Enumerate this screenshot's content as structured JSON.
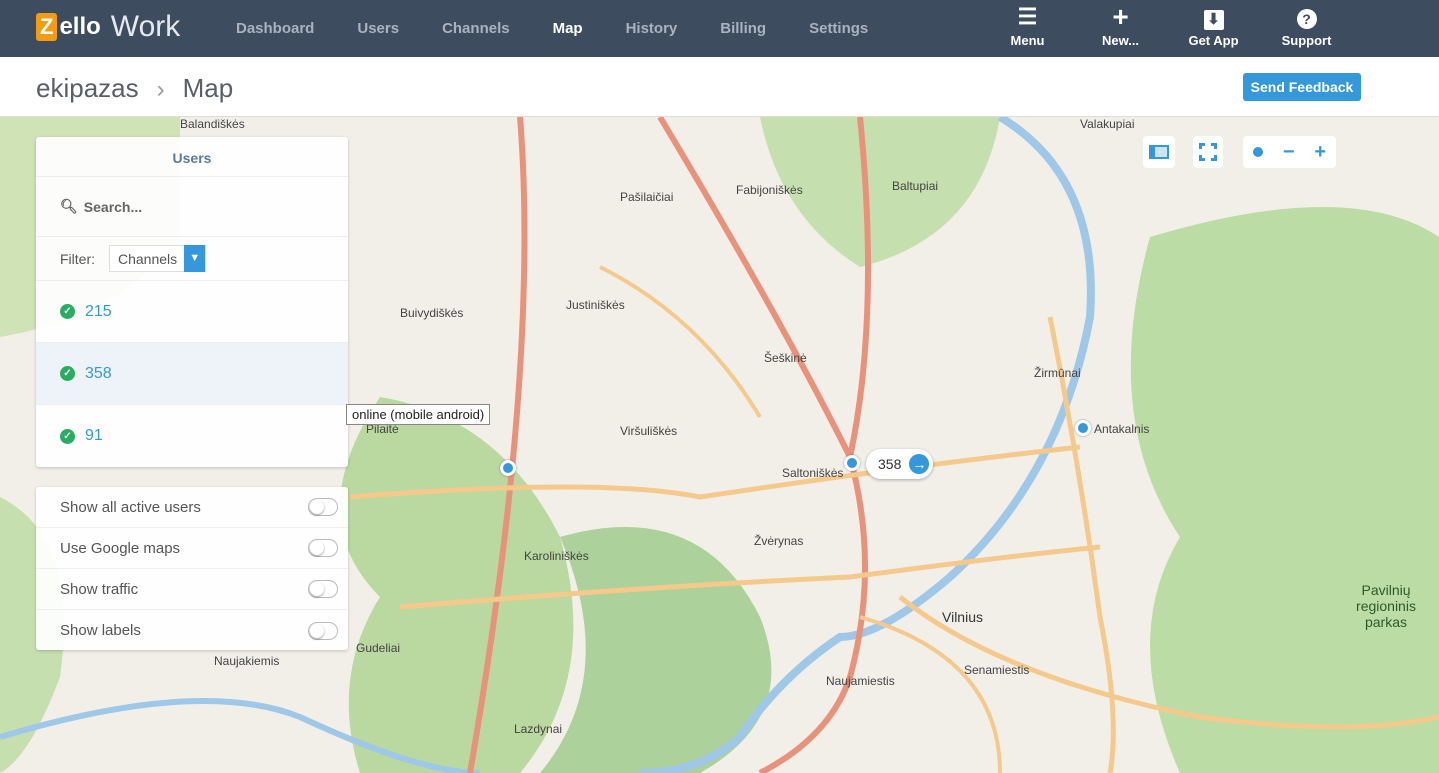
{
  "brand": {
    "logo": "Zello",
    "product": "Work",
    "accent": "#f39c12"
  },
  "nav": [
    {
      "label": "Dashboard"
    },
    {
      "label": "Users"
    },
    {
      "label": "Channels"
    },
    {
      "label": "Map",
      "active": true
    },
    {
      "label": "History"
    },
    {
      "label": "Billing"
    },
    {
      "label": "Settings"
    }
  ],
  "tools": [
    {
      "label": "Menu",
      "icon": "menu-icon",
      "glyph": "☰"
    },
    {
      "label": "New...",
      "icon": "plus-icon",
      "glyph": "+"
    },
    {
      "label": "Get App",
      "icon": "download-icon",
      "glyph": "⬇"
    },
    {
      "label": "Support",
      "icon": "question-icon",
      "glyph": "?"
    }
  ],
  "breadcrumb": {
    "org": "ekipazas",
    "sep": "›",
    "page": "Map"
  },
  "feedback": "Send Feedback",
  "users_panel": {
    "title": "Users",
    "search_placeholder": "Search...",
    "filter_label": "Filter:",
    "filter_value": "Channels",
    "users": [
      {
        "name": "215",
        "status": "online"
      },
      {
        "name": "358",
        "status": "online"
      },
      {
        "name": "91",
        "status": "online"
      }
    ]
  },
  "options": [
    {
      "label": "Show all active users",
      "on": false
    },
    {
      "label": "Use Google maps",
      "on": false
    },
    {
      "label": "Show traffic",
      "on": false
    },
    {
      "label": "Show labels",
      "on": false
    }
  ],
  "tooltip": "online (mobile android)",
  "marker_label": "358",
  "map_labels": [
    "Pašilaičiai",
    "Fabijoniškės",
    "Baltupiai",
    "Justiniškės",
    "Šeškinė",
    "Žirmūnai",
    "Antakalnis",
    "Viršuliškės",
    "Saltoniškės",
    "Žvėrynas",
    "Karoliniškės",
    "Vilnius",
    "Senamiestis",
    "Naujamiestis",
    "Lazdynai",
    "Pilaitė",
    "Buivydiškės",
    "Valakupiai",
    "Pavilnių regioninis parkas",
    "Gudeliai",
    "Naujakiemis",
    "Balandiškės"
  ],
  "colors": {
    "topbar": "#3e4c60",
    "primary": "#3498db",
    "online": "#27ae60"
  }
}
